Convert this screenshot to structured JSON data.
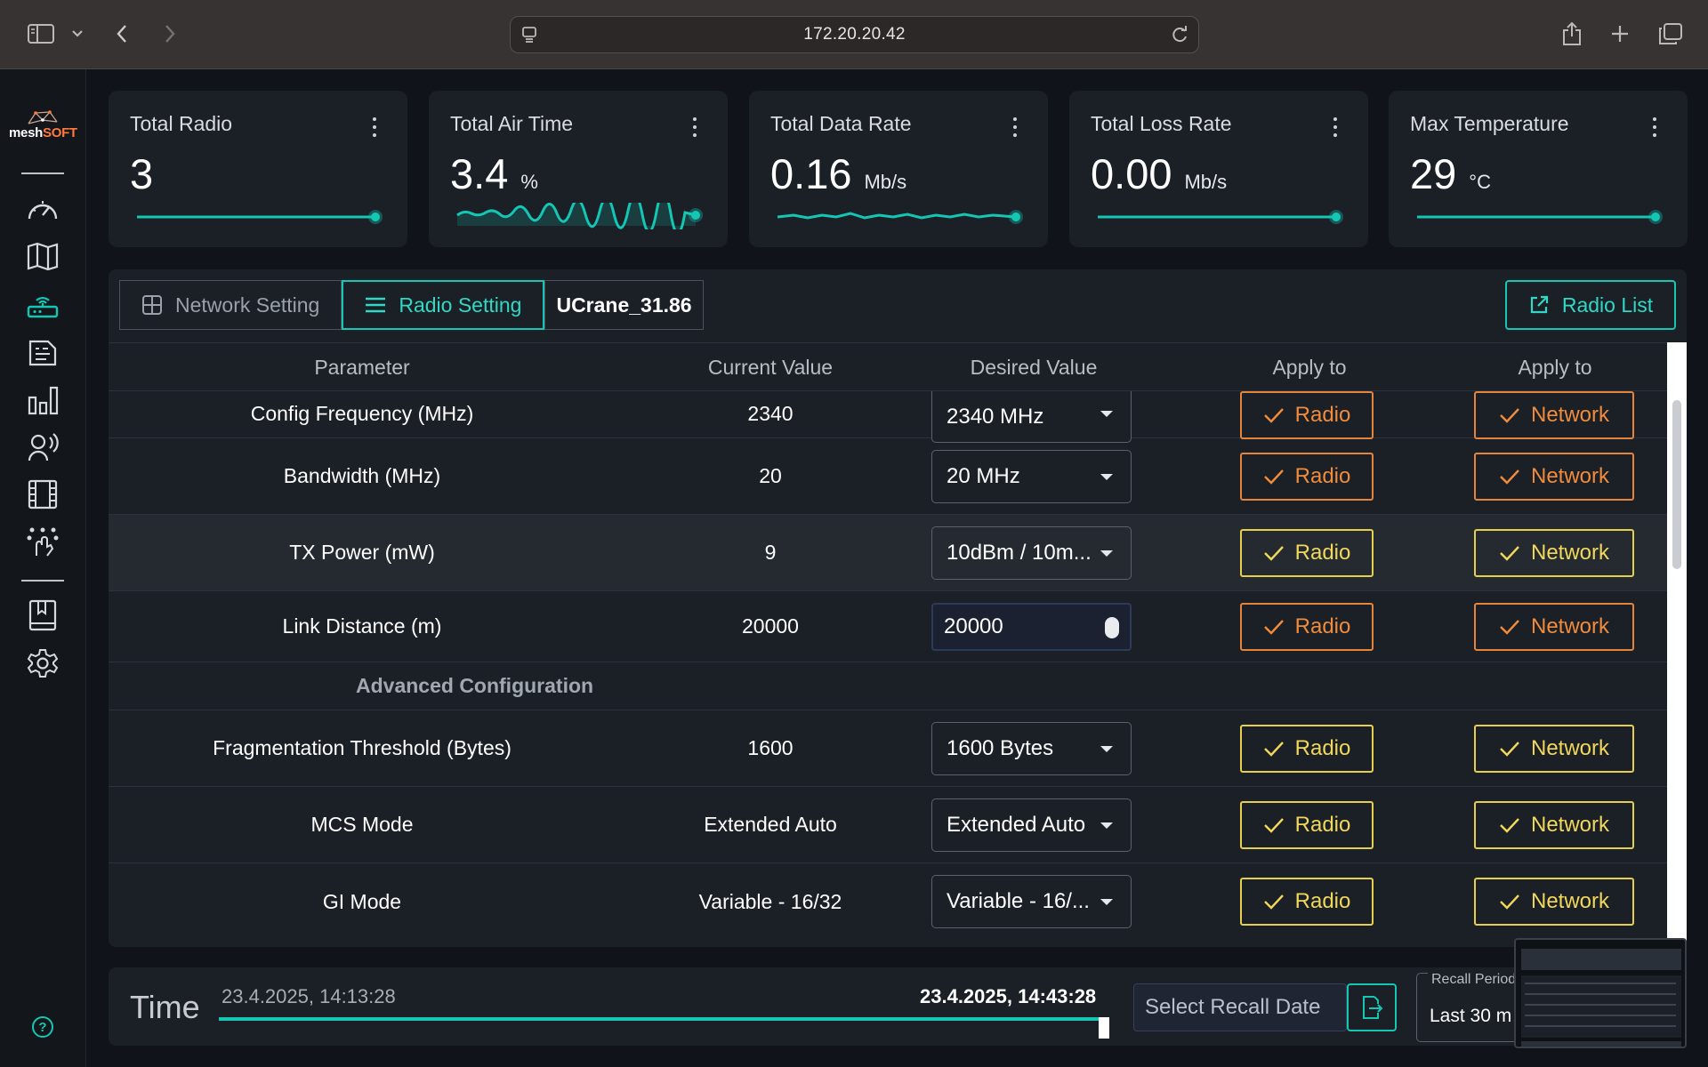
{
  "browser": {
    "url": "172.20.20.42"
  },
  "brand": {
    "logo_text_a": "mesh",
    "logo_text_b": "SOFT",
    "accent": "#14c7b4",
    "warning": "#f08c3c",
    "highlight": "#f1d85a"
  },
  "sidebar": {
    "icons": [
      "dashboard-gauge-icon",
      "map-icon",
      "router-icon",
      "devices-icon",
      "bar-chart-icon",
      "voice-icon",
      "video-icon",
      "mesh-network-icon",
      "book-icon",
      "settings-gear-icon"
    ],
    "active_icon": "router-icon",
    "help_label": "?"
  },
  "cards": [
    {
      "title": "Total Radio",
      "value": "3",
      "unit": ""
    },
    {
      "title": "Total Air Time",
      "value": "3.4",
      "unit": "%"
    },
    {
      "title": "Total Data Rate",
      "value": "0.16",
      "unit": "Mb/s"
    },
    {
      "title": "Total Loss Rate",
      "value": "0.00",
      "unit": "Mb/s"
    },
    {
      "title": "Max Temperature",
      "value": "29",
      "unit": "°C"
    }
  ],
  "tabs": {
    "network": "Network Setting",
    "radio": "Radio Setting",
    "device": "UCrane_31.86",
    "radio_list": "Radio List"
  },
  "table": {
    "headers": [
      "Parameter",
      "Current Value",
      "Desired Value",
      "Apply to",
      "Apply to"
    ],
    "apply_radio": "Radio",
    "apply_network": "Network",
    "rows": [
      {
        "param": "Config Frequency (MHz)",
        "current": "2340",
        "desired": "2340 MHz"
      },
      {
        "param": "Bandwidth (MHz)",
        "current": "20",
        "desired": "20 MHz"
      },
      {
        "param": "TX Power (mW)",
        "current": "9",
        "desired": "10dBm / 10m..."
      },
      {
        "param": "Link Distance (m)",
        "current": "20000",
        "desired": "20000"
      },
      {
        "section": "Advanced Configuration"
      },
      {
        "param": "Fragmentation Threshold (Bytes)",
        "current": "1600",
        "desired": "1600 Bytes"
      },
      {
        "param": "MCS Mode",
        "current": "Extended Auto",
        "desired": "Extended Auto"
      },
      {
        "param": "GI Mode",
        "current": "Variable - 16/32",
        "desired": "Variable - 16/..."
      }
    ]
  },
  "time": {
    "label": "Time",
    "start": "23.4.2025, 14:13:28",
    "end": "23.4.2025, 14:43:28",
    "recall_placeholder": "Select Recall Date",
    "period_label": "Recall Period",
    "period_value": "Last 30 m"
  }
}
